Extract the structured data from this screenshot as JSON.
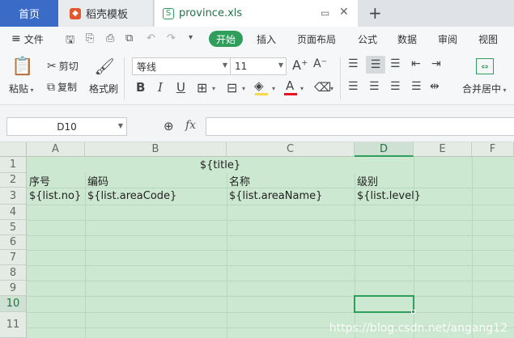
{
  "tabs": {
    "home": "首页",
    "template": "稻壳模板",
    "file": "province.xls",
    "new_tab": "+"
  },
  "menu": {
    "file": "文件",
    "items": [
      "开始",
      "插入",
      "页面布局",
      "公式",
      "数据",
      "审阅",
      "视图"
    ],
    "active_color": "#2f9d5b"
  },
  "ribbon": {
    "paste": "粘贴",
    "cut": "剪切",
    "copy": "复制",
    "format_painter": "格式刷",
    "font_name": "等线",
    "font_size": "11",
    "merge_center": "合并居中",
    "bold": "B",
    "italic": "I",
    "underline": "U",
    "font_color_letter": "A",
    "font_color": "#e81123",
    "fill_color": "#f5d94b"
  },
  "formula_bar": {
    "name_box": "D10",
    "fx": "fx",
    "value": ""
  },
  "sheet": {
    "columns": [
      "A",
      "B",
      "C",
      "D",
      "E",
      "F"
    ],
    "rows": [
      "1",
      "2",
      "3",
      "4",
      "5",
      "6",
      "7",
      "8",
      "9",
      "10",
      "11"
    ],
    "selected_column": "D",
    "selected_row": "10",
    "cells": {
      "title": "${title}",
      "a2": "序号",
      "b2": "编码",
      "c2": "名称",
      "d2": "级别",
      "a3": "${list.no}",
      "b3": "${list.areaCode}",
      "c3": "${list.areaName}",
      "d3": "${list.level}"
    }
  },
  "watermark": "https://blog.csdn.net/angang12"
}
